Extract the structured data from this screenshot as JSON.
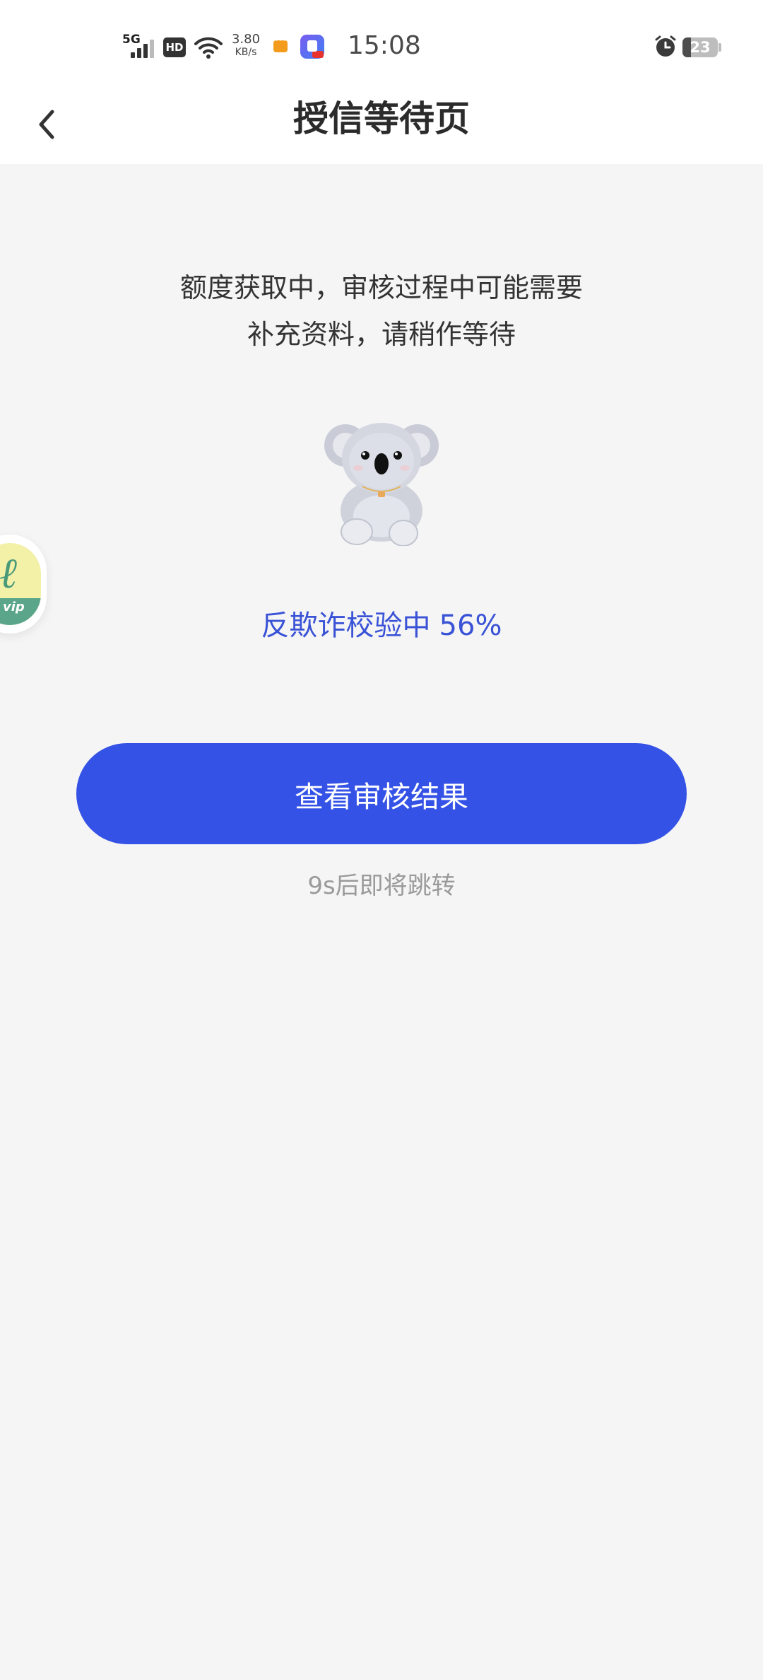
{
  "status_bar": {
    "network": "5G",
    "hd_label": "HD",
    "speed_value": "3.80",
    "speed_unit": "KB/s",
    "time": "15:08",
    "battery": "23",
    "battery_level": 0.23,
    "icons": [
      "signal-icon",
      "hd-icon",
      "wifi-icon",
      "message-icon",
      "app-notification-icon",
      "alarm-icon",
      "battery-icon"
    ]
  },
  "header": {
    "title": "授信等待页",
    "back_icon": "chevron-left-icon"
  },
  "main": {
    "notice_line1": "额度获取中，审核过程中可能需要",
    "notice_line2": "补充资料，请稍作等待",
    "mascot": "koala-illustration",
    "progress_label": "反欺诈校验中",
    "progress_value": "56%",
    "button_label": "查看审核结果",
    "countdown": "9s后即将跳转"
  },
  "float_badge": {
    "text": "vip",
    "icon": "vip-badge-icon"
  },
  "colors": {
    "accent": "#3452e6",
    "progress_text": "#3a53d6",
    "background": "#f5f5f6",
    "muted_text": "#9a9a9a"
  }
}
